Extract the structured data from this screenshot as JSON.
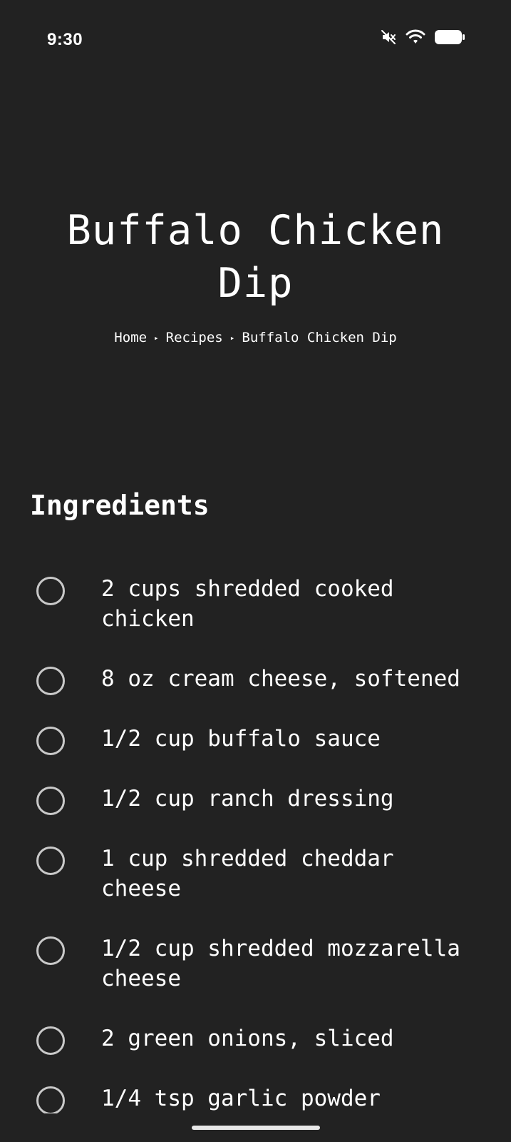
{
  "status_bar": {
    "time": "9:30",
    "icons": [
      "mute-icon",
      "wifi-icon",
      "battery-icon"
    ]
  },
  "recipe": {
    "title": "Buffalo Chicken Dip",
    "breadcrumb": {
      "home": "Home",
      "separator": "▸",
      "recipes": "Recipes",
      "current": "Buffalo Chicken Dip"
    }
  },
  "ingredients": {
    "heading": "Ingredients",
    "items": [
      "2 cups shredded cooked chicken",
      "8 oz cream cheese, softened",
      "1/2 cup buffalo sauce",
      "1/2 cup ranch dressing",
      "1 cup shredded cheddar cheese",
      "1/2 cup shredded mozzarella cheese",
      "2 green onions, sliced",
      "1/4 tsp garlic powder"
    ]
  },
  "colors": {
    "background": "#222222",
    "text": "#ffffff",
    "checkbox_border": "#c9c9c9"
  }
}
